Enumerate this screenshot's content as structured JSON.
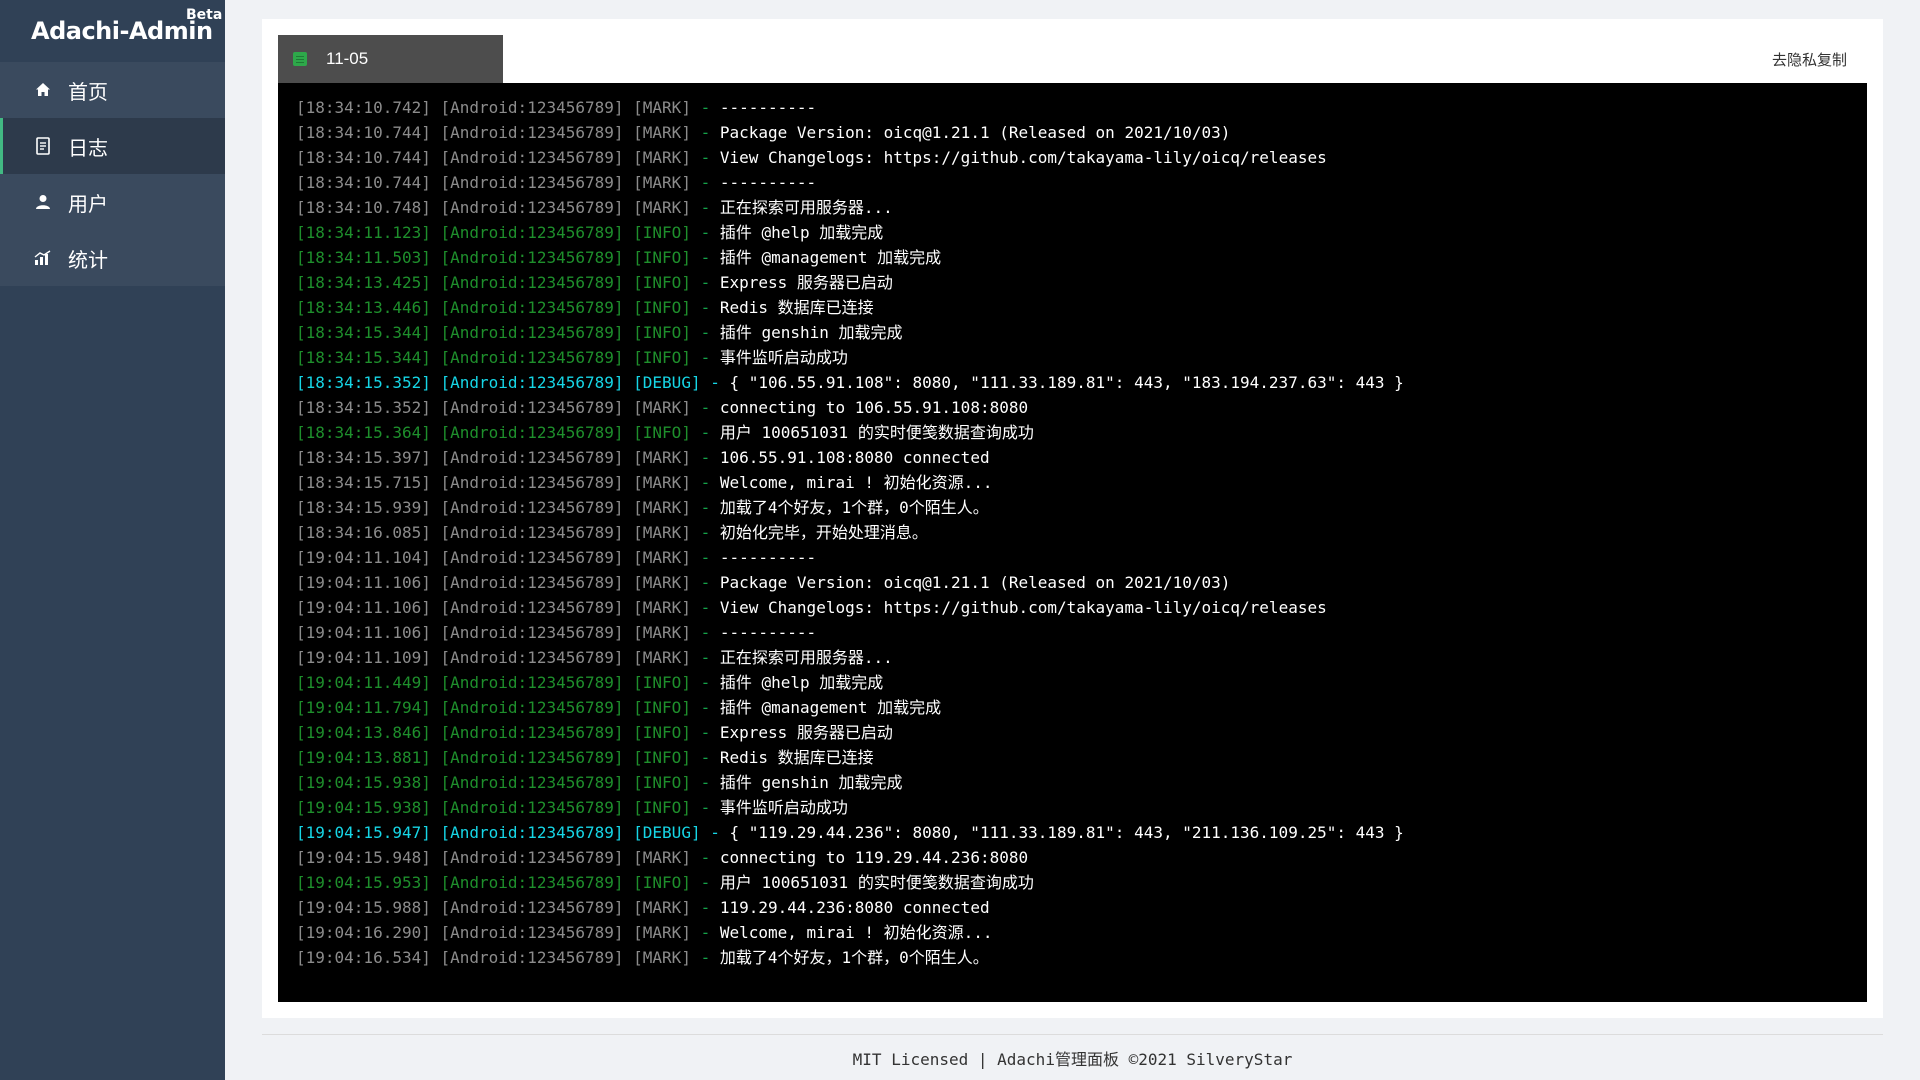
{
  "sidebar": {
    "brand_title": "Adachi-Admin",
    "brand_badge": "Beta",
    "items": [
      {
        "label": "首页",
        "icon": "home-icon"
      },
      {
        "label": "日志",
        "icon": "document-icon"
      },
      {
        "label": "用户",
        "icon": "user-icon"
      },
      {
        "label": "统计",
        "icon": "chart-icon"
      }
    ],
    "active_index": 1
  },
  "tab": {
    "label": "11-05",
    "icon": "log-file-icon"
  },
  "toolbar": {
    "copy_label": "去隐私复制"
  },
  "colors": {
    "sidebar_bg": "#304156",
    "active_indicator": "#42b983",
    "terminal_bg": "#000000",
    "mark": "#8c8c8c",
    "info": "#1e8f2c",
    "debug": "#16d6e6"
  },
  "log_lines": [
    {
      "time": "18:34:10.742",
      "src": "Android:123456789",
      "level": "MARK",
      "msg": "----------"
    },
    {
      "time": "18:34:10.744",
      "src": "Android:123456789",
      "level": "MARK",
      "msg": "Package Version: oicq@1.21.1 (Released on 2021/10/03)"
    },
    {
      "time": "18:34:10.744",
      "src": "Android:123456789",
      "level": "MARK",
      "msg": "View Changelogs: https://github.com/takayama-lily/oicq/releases"
    },
    {
      "time": "18:34:10.744",
      "src": "Android:123456789",
      "level": "MARK",
      "msg": "----------"
    },
    {
      "time": "18:34:10.748",
      "src": "Android:123456789",
      "level": "MARK",
      "msg": "正在探索可用服务器..."
    },
    {
      "time": "18:34:11.123",
      "src": "Android:123456789",
      "level": "INFO",
      "msg": "插件 @help 加载完成"
    },
    {
      "time": "18:34:11.503",
      "src": "Android:123456789",
      "level": "INFO",
      "msg": "插件 @management 加载完成"
    },
    {
      "time": "18:34:13.425",
      "src": "Android:123456789",
      "level": "INFO",
      "msg": "Express 服务器已启动"
    },
    {
      "time": "18:34:13.446",
      "src": "Android:123456789",
      "level": "INFO",
      "msg": "Redis 数据库已连接"
    },
    {
      "time": "18:34:15.344",
      "src": "Android:123456789",
      "level": "INFO",
      "msg": "插件 genshin 加载完成"
    },
    {
      "time": "18:34:15.344",
      "src": "Android:123456789",
      "level": "INFO",
      "msg": "事件监听启动成功"
    },
    {
      "time": "18:34:15.352",
      "src": "Android:123456789",
      "level": "DEBUG",
      "msg": "{ \"106.55.91.108\": 8080, \"111.33.189.81\": 443, \"183.194.237.63\": 443 }"
    },
    {
      "time": "18:34:15.352",
      "src": "Android:123456789",
      "level": "MARK",
      "msg": "connecting to 106.55.91.108:8080"
    },
    {
      "time": "18:34:15.364",
      "src": "Android:123456789",
      "level": "INFO",
      "msg": "用户 100651031 的实时便笺数据查询成功"
    },
    {
      "time": "18:34:15.397",
      "src": "Android:123456789",
      "level": "MARK",
      "msg": "106.55.91.108:8080 connected"
    },
    {
      "time": "18:34:15.715",
      "src": "Android:123456789",
      "level": "MARK",
      "msg": "Welcome, mirai ! 初始化资源..."
    },
    {
      "time": "18:34:15.939",
      "src": "Android:123456789",
      "level": "MARK",
      "msg": "加载了4个好友，1个群，0个陌生人。"
    },
    {
      "time": "18:34:16.085",
      "src": "Android:123456789",
      "level": "MARK",
      "msg": "初始化完毕，开始处理消息。"
    },
    {
      "time": "19:04:11.104",
      "src": "Android:123456789",
      "level": "MARK",
      "msg": "----------"
    },
    {
      "time": "19:04:11.106",
      "src": "Android:123456789",
      "level": "MARK",
      "msg": "Package Version: oicq@1.21.1 (Released on 2021/10/03)"
    },
    {
      "time": "19:04:11.106",
      "src": "Android:123456789",
      "level": "MARK",
      "msg": "View Changelogs: https://github.com/takayama-lily/oicq/releases"
    },
    {
      "time": "19:04:11.106",
      "src": "Android:123456789",
      "level": "MARK",
      "msg": "----------"
    },
    {
      "time": "19:04:11.109",
      "src": "Android:123456789",
      "level": "MARK",
      "msg": "正在探索可用服务器..."
    },
    {
      "time": "19:04:11.449",
      "src": "Android:123456789",
      "level": "INFO",
      "msg": "插件 @help 加载完成"
    },
    {
      "time": "19:04:11.794",
      "src": "Android:123456789",
      "level": "INFO",
      "msg": "插件 @management 加载完成"
    },
    {
      "time": "19:04:13.846",
      "src": "Android:123456789",
      "level": "INFO",
      "msg": "Express 服务器已启动"
    },
    {
      "time": "19:04:13.881",
      "src": "Android:123456789",
      "level": "INFO",
      "msg": "Redis 数据库已连接"
    },
    {
      "time": "19:04:15.938",
      "src": "Android:123456789",
      "level": "INFO",
      "msg": "插件 genshin 加载完成"
    },
    {
      "time": "19:04:15.938",
      "src": "Android:123456789",
      "level": "INFO",
      "msg": "事件监听启动成功"
    },
    {
      "time": "19:04:15.947",
      "src": "Android:123456789",
      "level": "DEBUG",
      "msg": "{ \"119.29.44.236\": 8080, \"111.33.189.81\": 443, \"211.136.109.25\": 443 }"
    },
    {
      "time": "19:04:15.948",
      "src": "Android:123456789",
      "level": "MARK",
      "msg": "connecting to 119.29.44.236:8080"
    },
    {
      "time": "19:04:15.953",
      "src": "Android:123456789",
      "level": "INFO",
      "msg": "用户 100651031 的实时便笺数据查询成功"
    },
    {
      "time": "19:04:15.988",
      "src": "Android:123456789",
      "level": "MARK",
      "msg": "119.29.44.236:8080 connected"
    },
    {
      "time": "19:04:16.290",
      "src": "Android:123456789",
      "level": "MARK",
      "msg": "Welcome, mirai ! 初始化资源..."
    },
    {
      "time": "19:04:16.534",
      "src": "Android:123456789",
      "level": "MARK",
      "msg": "加载了4个好友，1个群，0个陌生人。"
    }
  ],
  "footer": {
    "text": "MIT Licensed | Adachi管理面板 ©2021 SilveryStar"
  }
}
